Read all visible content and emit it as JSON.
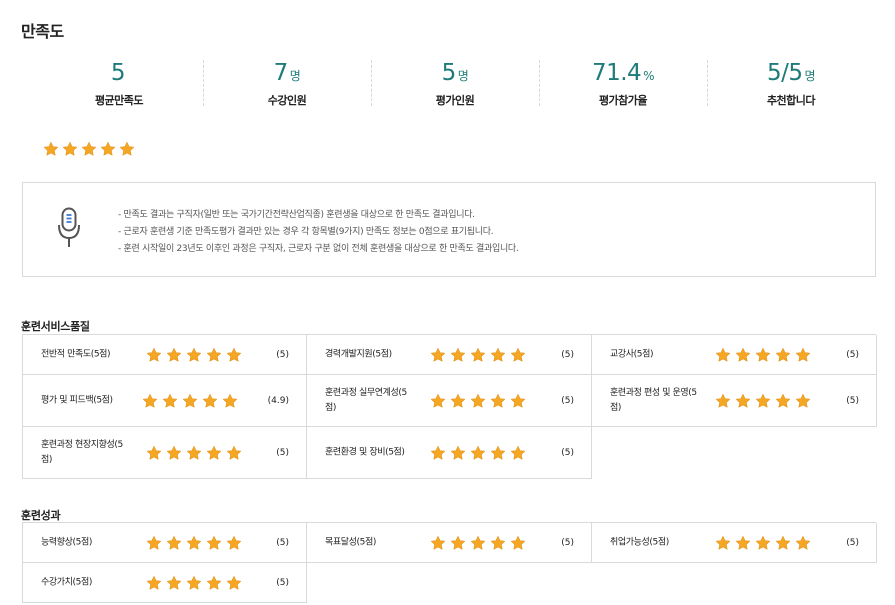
{
  "page": {
    "title": "만족도"
  },
  "stats": [
    {
      "value": "5",
      "unit": "",
      "label": "평균만족도"
    },
    {
      "value": "7",
      "unit": "명",
      "label": "수강인원"
    },
    {
      "value": "5",
      "unit": "명",
      "label": "평가인원"
    },
    {
      "value": "71.4",
      "unit": "%",
      "label": "평가참가율"
    },
    {
      "value": "5/5",
      "unit": "명",
      "label": "추천합니다"
    }
  ],
  "overall_rating": {
    "stars_filled": 5,
    "stars_total": 5
  },
  "notice": {
    "icon": "microphone-icon",
    "lines": [
      "- 만족도 결과는 구직자(일반 또는 국가기간전략산업직종) 훈련생을 대상으로 한 만족도 결과입니다.",
      "- 근로자 훈련생 기준 만족도평가 결과만 있는 경우 각 항목별(9가지) 만족도 정보는 0점으로 표기됩니다.",
      "- 훈련 시작일이 23년도 이후인 과정은 구직자, 근로자 구분 없이 전체 훈련생을 대상으로 한 만족도 결과입니다."
    ]
  },
  "colors": {
    "accent": "#1e7b7a",
    "star_fill": "#f5a623",
    "border": "#d9d9d9"
  },
  "service_quality": {
    "title": "훈련서비스품질",
    "items": [
      {
        "label": "전반적 만족도(5점)",
        "score": "(5)",
        "stars": 5
      },
      {
        "label": "경력개발지원(5점)",
        "score": "(5)",
        "stars": 5
      },
      {
        "label": "교강사(5점)",
        "score": "(5)",
        "stars": 5
      },
      {
        "label": "평가 및 피드백(5점)",
        "score": "(4.9)",
        "stars": 5
      },
      {
        "label": "훈련과정 실무연계성(5점)",
        "score": "(5)",
        "stars": 5
      },
      {
        "label": "훈련과정 편성 및 운영(5점)",
        "score": "(5)",
        "stars": 5
      },
      {
        "label": "훈련과정 현장지향성(5점)",
        "score": "(5)",
        "stars": 5
      },
      {
        "label": "훈련환경 및 장비(5점)",
        "score": "(5)",
        "stars": 5
      }
    ]
  },
  "outcomes": {
    "title": "훈련성과",
    "items": [
      {
        "label": "능력향상(5점)",
        "score": "(5)",
        "stars": 5
      },
      {
        "label": "목표달성(5점)",
        "score": "(5)",
        "stars": 5
      },
      {
        "label": "취업가능성(5점)",
        "score": "(5)",
        "stars": 5
      },
      {
        "label": "수강가치(5점)",
        "score": "(5)",
        "stars": 5
      }
    ]
  }
}
